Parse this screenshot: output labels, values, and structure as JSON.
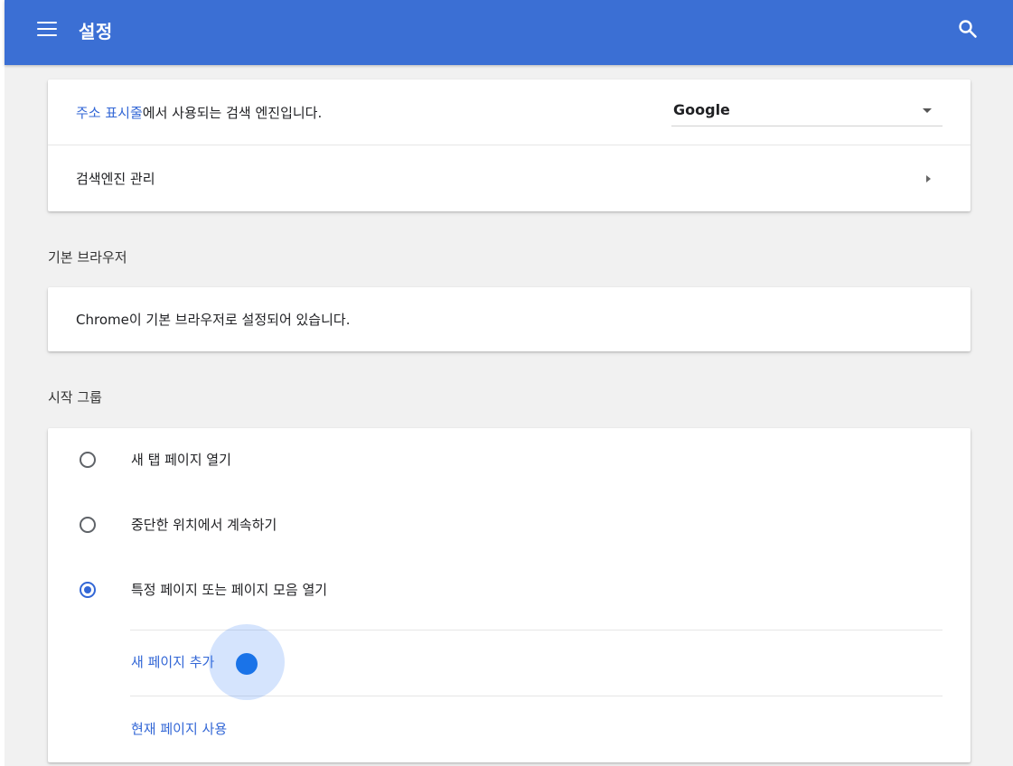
{
  "header": {
    "title": "설정",
    "menu_icon": "hamburger-menu-icon",
    "search_icon": "search-icon",
    "bar_color": "#3b6fd4"
  },
  "search_engine": {
    "description_link": "주소 표시줄",
    "description_rest": "에서 사용되는 검색 엔진입니다.",
    "selected_engine": "Google",
    "manage_label": "검색엔진 관리"
  },
  "default_browser": {
    "section_title": "기본 브라우저",
    "status_text": "Chrome이 기본 브라우저로 설정되어 있습니다."
  },
  "startup": {
    "section_title": "시작 그룹",
    "options": [
      {
        "label": "새 탭 페이지 열기",
        "checked": false
      },
      {
        "label": "중단한 위치에서 계속하기",
        "checked": false
      },
      {
        "label": "특정 페이지 또는 페이지 모음 열기",
        "checked": true
      }
    ],
    "add_page_label": "새 페이지 추가",
    "use_current_label": "현재 페이지 사용"
  },
  "accent_color": "#3367d6"
}
